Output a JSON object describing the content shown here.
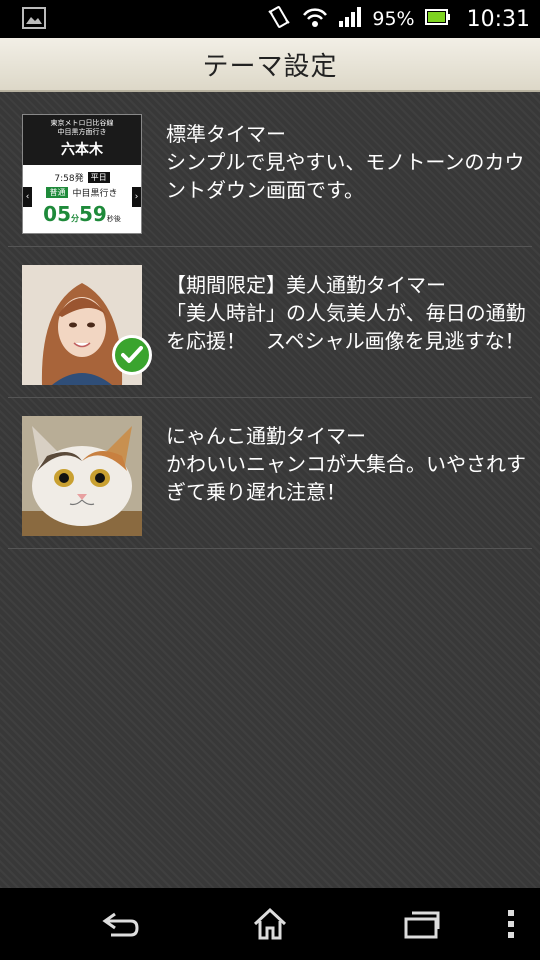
{
  "status_bar": {
    "battery_percent": "95%",
    "time": "10:31",
    "icons": [
      "image-notification-icon",
      "vibrate-icon",
      "wifi-icon",
      "signal-icon",
      "battery-icon"
    ]
  },
  "header": {
    "title": "テーマ設定"
  },
  "themes": [
    {
      "title": "標準タイマー",
      "description": "シンプルで見やすい、モノトーンのカウントダウン画面です。",
      "selected": false,
      "thumbnail": {
        "line": "東京メトロ日比谷線",
        "direction": "中目黒方面行き",
        "station": "六本木",
        "depart": "7:58発",
        "day_badge": "平日",
        "train_type": "普通",
        "destination": "中目黒行き",
        "minutes": "05",
        "min_unit": "分",
        "seconds": "59",
        "sec_unit": "秒後"
      }
    },
    {
      "title": "【期間限定】美人通勤タイマー",
      "description": "「美人時計」の人気美人が、毎日の通勤を応援！　スペシャル画像を見逃すな！",
      "selected": true
    },
    {
      "title": "にゃんこ通勤タイマー",
      "description": "かわいいニャンコが大集合。いやされすぎて乗り遅れ注意！",
      "selected": false
    }
  ],
  "navbar": {
    "icons": [
      "back-icon",
      "home-icon",
      "recent-apps-icon",
      "menu-icon"
    ]
  },
  "colors": {
    "check": "#3aa42e",
    "header_bg": "#e8e4d8",
    "content_bg": "#383838"
  }
}
